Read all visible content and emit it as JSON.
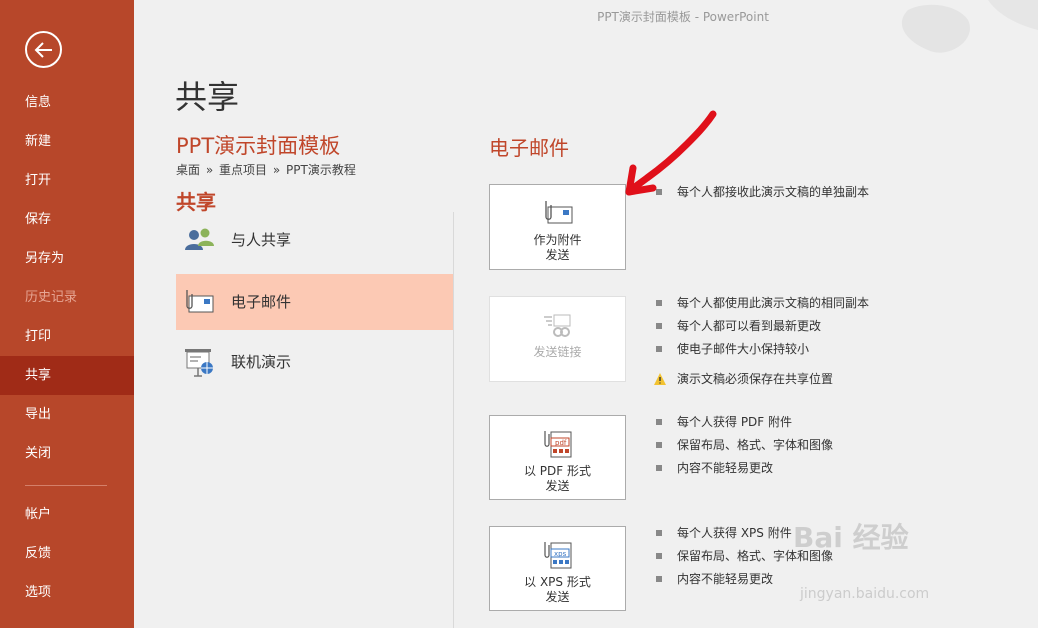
{
  "window": {
    "title": "PPT演示封面模板  -  PowerPoint"
  },
  "sidebar": {
    "items": [
      {
        "label": "信息"
      },
      {
        "label": "新建"
      },
      {
        "label": "打开"
      },
      {
        "label": "保存"
      },
      {
        "label": "另存为"
      },
      {
        "label": "历史记录",
        "disabled": true
      },
      {
        "label": "打印"
      },
      {
        "label": "共享",
        "active": true
      },
      {
        "label": "导出"
      },
      {
        "label": "关闭"
      },
      {
        "label": "帐户"
      },
      {
        "label": "反馈"
      },
      {
        "label": "选项"
      }
    ]
  },
  "page": {
    "title": "共享",
    "doc_title": "PPT演示封面模板",
    "breadcrumb": [
      "桌面",
      "»",
      "重点项目",
      "»",
      "PPT演示教程"
    ],
    "section_label": "共享"
  },
  "share_options": [
    {
      "label": "与人共享",
      "icon": "people-icon"
    },
    {
      "label": "电子邮件",
      "icon": "email-icon",
      "selected": true
    },
    {
      "label": "联机演示",
      "icon": "present-online-icon"
    }
  ],
  "email": {
    "header": "电子邮件",
    "buttons": [
      {
        "label": "作为附件\n发送",
        "icon": "attachment-icon"
      },
      {
        "label": "发送链接",
        "icon": "send-link-icon",
        "disabled": true
      },
      {
        "label": "以 PDF 形式\n发送",
        "icon": "pdf-icon"
      },
      {
        "label": "以 XPS 形式\n发送",
        "icon": "xps-icon"
      }
    ],
    "bullets": {
      "attach": [
        "每个人都接收此演示文稿的单独副本"
      ],
      "link": [
        "每个人都使用此演示文稿的相同副本",
        "每个人都可以看到最新更改",
        "使电子邮件大小保持较小"
      ],
      "link_warning": "演示文稿必须保存在共享位置",
      "pdf": [
        "每个人获得 PDF 附件",
        "保留布局、格式、字体和图像",
        "内容不能轻易更改"
      ],
      "xps": [
        "每个人获得 XPS 附件",
        "保留布局、格式、字体和图像",
        "内容不能轻易更改"
      ]
    }
  },
  "watermark": {
    "main": "Bai 经验",
    "sub": "jingyan.baidu.com"
  },
  "colors": {
    "sidebar": "#b7472a",
    "accent": "#c0462a",
    "selected": "#fcc9b4",
    "arrow": "#e0101a"
  }
}
